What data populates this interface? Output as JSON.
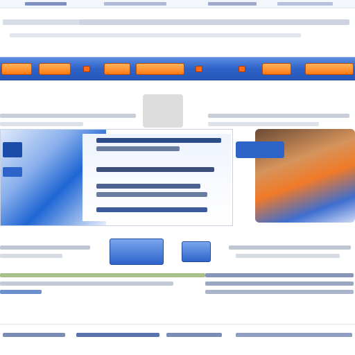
{
  "page": {
    "title": "",
    "description": ""
  },
  "colors": {
    "nav_bar": "#2e63c9",
    "nav_buttons": "#ff7b12",
    "feature_blue": "#1f66d4",
    "promo_orange": "#f07a28"
  },
  "navigation": {
    "items": [
      {
        "label": ""
      },
      {
        "label": ""
      },
      {
        "label": ""
      },
      {
        "label": ""
      },
      {
        "label": ""
      },
      {
        "label": ""
      },
      {
        "label": ""
      },
      {
        "label": ""
      },
      {
        "label": ""
      }
    ]
  },
  "feature": {
    "headline": "",
    "body": "",
    "link": ""
  },
  "promo": {
    "title": ""
  },
  "footer": {
    "links": ""
  }
}
